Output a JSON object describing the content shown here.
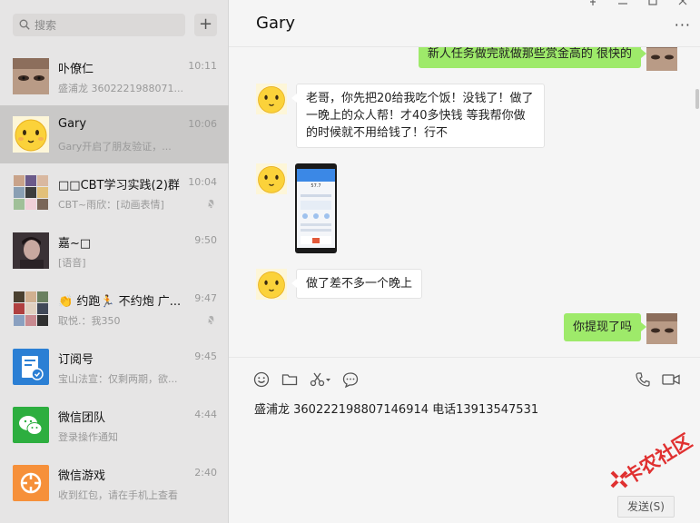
{
  "search": {
    "placeholder": "搜索",
    "icon": "search-icon"
  },
  "add_button": {
    "label": "+"
  },
  "colors": {
    "active_item": "#c9c8c7",
    "bubble_out": "#9eea6a",
    "bubble_in": "#ffffff",
    "panel_left": "#e6e5e5"
  },
  "chats": [
    {
      "name": "卟僚仁",
      "time": "10:11",
      "preview": "盛浦龙 3602221988071...",
      "avatar": "face-photo-avatar",
      "muted": false
    },
    {
      "name": "Gary",
      "time": "10:06",
      "preview": "Gary开启了朋友验证，...",
      "avatar": "smiley-avatar",
      "muted": false,
      "active": true
    },
    {
      "name": "□□CBT学习实践(2)群",
      "time": "10:04",
      "preview": "CBT~雨欣：[动画表情]",
      "avatar": "group-grid-avatar",
      "muted": true
    },
    {
      "name": "嘉~□",
      "time": "9:50",
      "preview": "[语音]",
      "avatar": "dark-portrait-avatar",
      "muted": false
    },
    {
      "name": "👏 约跑🏃 不约炮 广...",
      "time": "9:47",
      "preview": "取悦.：我350",
      "avatar": "group-grid-avatar",
      "muted": true
    },
    {
      "name": "订阅号",
      "time": "9:45",
      "preview": "宝山法宣：仅剩两期，欲...",
      "avatar": "subscription-icon",
      "muted": false
    },
    {
      "name": "微信团队",
      "time": "4:44",
      "preview": "登录操作通知",
      "avatar": "wechat-logo-icon",
      "muted": false
    },
    {
      "name": "微信游戏",
      "time": "2:40",
      "preview": "收到红包，请在手机上查看",
      "avatar": "wechat-games-icon",
      "muted": false
    }
  ],
  "conversation": {
    "title": "Gary",
    "more_label": "···",
    "messages": [
      {
        "direction": "out",
        "text": "新人任务做完就做那些赏金高的 很快的"
      },
      {
        "direction": "in",
        "text": "老哥，你先把20给我吃个饭！没钱了！做了一晚上的众人帮！才40多快钱   等我帮你做的时候就不用给钱了！行不"
      },
      {
        "direction": "in",
        "type": "image",
        "image_label": "phone-screenshot-image",
        "screenshot_value": "57.7"
      },
      {
        "direction": "in",
        "text": "做了差不多一个晚上"
      },
      {
        "direction": "out",
        "text": "你提现了吗"
      }
    ]
  },
  "composer": {
    "text": "盛浦龙 360222198807146914 电话13913547531",
    "send_label": "发送(S)",
    "tools": [
      "emoji-icon",
      "folder-icon",
      "scissors-icon",
      "chat-bubble-icon",
      "phone-icon",
      "video-icon"
    ]
  },
  "watermark": {
    "text": "卡农社区"
  }
}
